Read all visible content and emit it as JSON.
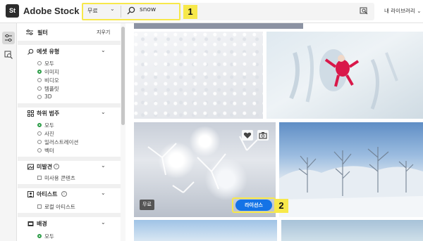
{
  "header": {
    "logo_badge": "St",
    "logo_text": "Adobe Stock",
    "filter_value": "무료",
    "search_value": "snow",
    "library_label": "내 라이브러리"
  },
  "annotations": [
    "1",
    "2"
  ],
  "filters": {
    "title": "필터",
    "clear": "지우기",
    "asset_type": {
      "title": "에셋 유형",
      "options": [
        "모두",
        "이미지",
        "비디오",
        "템플릿",
        "3D"
      ],
      "selected": "이미지"
    },
    "subcategory": {
      "title": "하위 범주",
      "options": [
        "모두",
        "사진",
        "일러스트레이션",
        "벡터"
      ],
      "selected": "모두"
    },
    "unreleased": {
      "title": "미발견",
      "options": [
        "미사용 콘텐츠"
      ]
    },
    "artist": {
      "title": "아티스트",
      "options": [
        "로컬 아티스트"
      ]
    },
    "background": {
      "title": "배경",
      "options": [
        "모두"
      ],
      "selected": "모두"
    }
  },
  "grid": {
    "free_badge": "무료",
    "license_button": "라이선스"
  },
  "colors": {
    "accent": "#1473e6",
    "selected_radio": "#2d9d48",
    "highlight": "#f7e84a"
  }
}
